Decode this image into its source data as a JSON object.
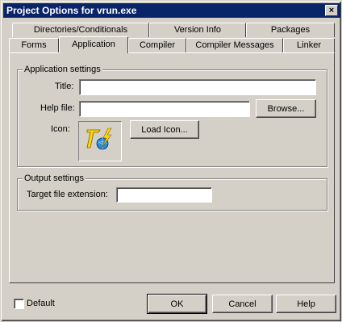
{
  "window": {
    "title": "Project Options for vrun.exe",
    "close_glyph": "×"
  },
  "tabs_back": [
    {
      "label": "Directories/Conditionals"
    },
    {
      "label": "Version Info"
    },
    {
      "label": "Packages"
    }
  ],
  "tabs_front": [
    {
      "label": "Forms"
    },
    {
      "label": "Application"
    },
    {
      "label": "Compiler"
    },
    {
      "label": "Compiler Messages"
    },
    {
      "label": "Linker"
    }
  ],
  "app_settings": {
    "group_label": "Application settings",
    "title_label": "Title:",
    "title_value": "",
    "helpfile_label": "Help file:",
    "helpfile_value": "",
    "browse_label": "Browse...",
    "icon_label": "Icon:",
    "load_icon_label": "Load Icon..."
  },
  "output_settings": {
    "group_label": "Output settings",
    "ext_label": "Target file extension:",
    "ext_value": ""
  },
  "footer": {
    "default_label": "Default",
    "default_checked": false,
    "ok_label": "OK",
    "cancel_label": "Cancel",
    "help_label": "Help"
  },
  "colors": {
    "titlebar": "#0a246a",
    "face": "#d4d0c8",
    "icon_yellow": "#ffd800",
    "icon_globe": "#2a8ad4"
  }
}
